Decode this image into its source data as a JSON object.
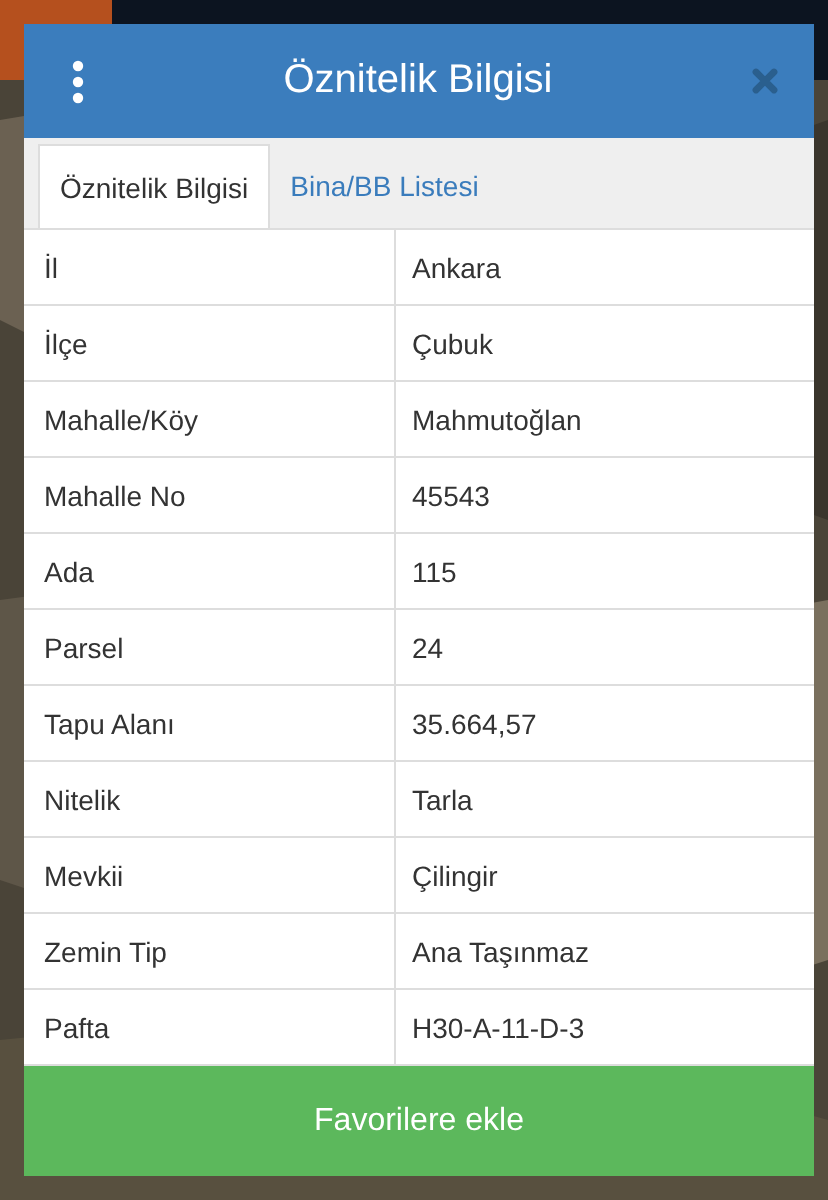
{
  "dialog": {
    "title": "Öznitelik Bilgisi"
  },
  "tabs": [
    {
      "label": "Öznitelik Bilgisi",
      "selected": true
    },
    {
      "label": "Bina/BB Listesi",
      "selected": false
    }
  ],
  "table": {
    "rows": [
      {
        "label": "İl",
        "value": "Ankara"
      },
      {
        "label": "İlçe",
        "value": "Çubuk"
      },
      {
        "label": "Mahalle/Köy",
        "value": "Mahmutoğlan"
      },
      {
        "label": "Mahalle No",
        "value": "45543"
      },
      {
        "label": "Ada",
        "value": "115"
      },
      {
        "label": "Parsel",
        "value": "24"
      },
      {
        "label": "Tapu Alanı",
        "value": "35.664,57"
      },
      {
        "label": "Nitelik",
        "value": "Tarla"
      },
      {
        "label": "Mevkii",
        "value": "Çilingir"
      },
      {
        "label": "Zemin Tip",
        "value": "Ana Taşınmaz"
      },
      {
        "label": "Pafta",
        "value": "H30-A-11-D-3"
      }
    ]
  },
  "action_button": {
    "label": "Favorilere ekle"
  }
}
